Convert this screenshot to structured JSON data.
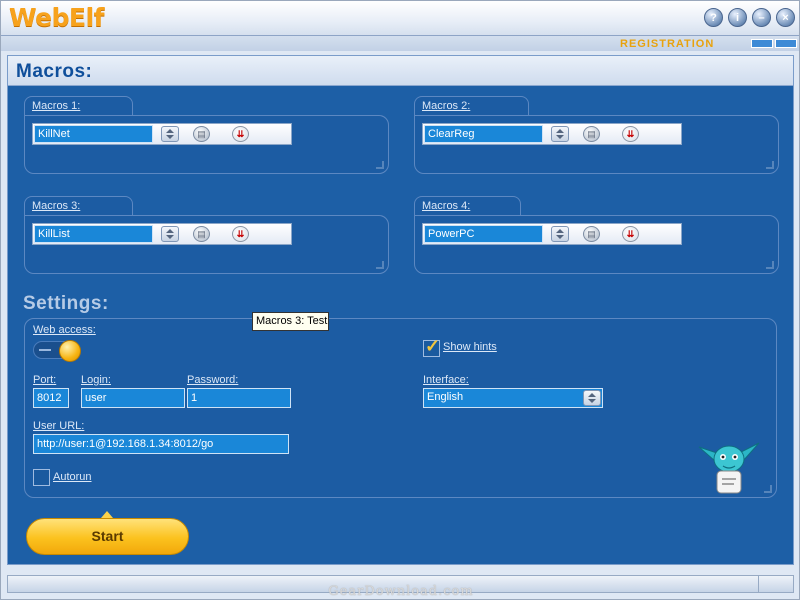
{
  "window": {
    "title": "WebElf",
    "registration_label": "REGISTRATION",
    "buttons": {
      "help": "?",
      "info": "i",
      "minimize": "–",
      "close": "×"
    }
  },
  "macros": {
    "heading": "Macros:",
    "items": [
      {
        "label": "Macros 1:",
        "value": "KillNet"
      },
      {
        "label": "Macros 2:",
        "value": "ClearReg"
      },
      {
        "label": "Macros 3:",
        "value": "KillList"
      },
      {
        "label": "Macros 4:",
        "value": "PowerPC"
      }
    ],
    "tooltip": "Macros 3: Test"
  },
  "settings": {
    "heading": "Settings:",
    "web_access_label": "Web access:",
    "web_access_on": true,
    "port_label": "Port:",
    "port_value": "8012",
    "login_label": "Login:",
    "login_value": "user",
    "password_label": "Password:",
    "password_value": "1",
    "user_url_label": "User URL:",
    "user_url_value": "http://user:1@192.168.1.34:8012/go",
    "autorun_label": "Autorun",
    "autorun_checked": false,
    "show_hints_label": "Show hints",
    "show_hints_checked": true,
    "interface_label": "Interface:",
    "interface_value": "English"
  },
  "actions": {
    "start_label": "Start"
  },
  "footer": {
    "watermark": "GearDownload.com"
  },
  "colors": {
    "panel_blue": "#1d5fa6",
    "field_blue": "#1a87d8",
    "title_orange": "#f7a21c",
    "start_yellow": "#fbc21e"
  }
}
